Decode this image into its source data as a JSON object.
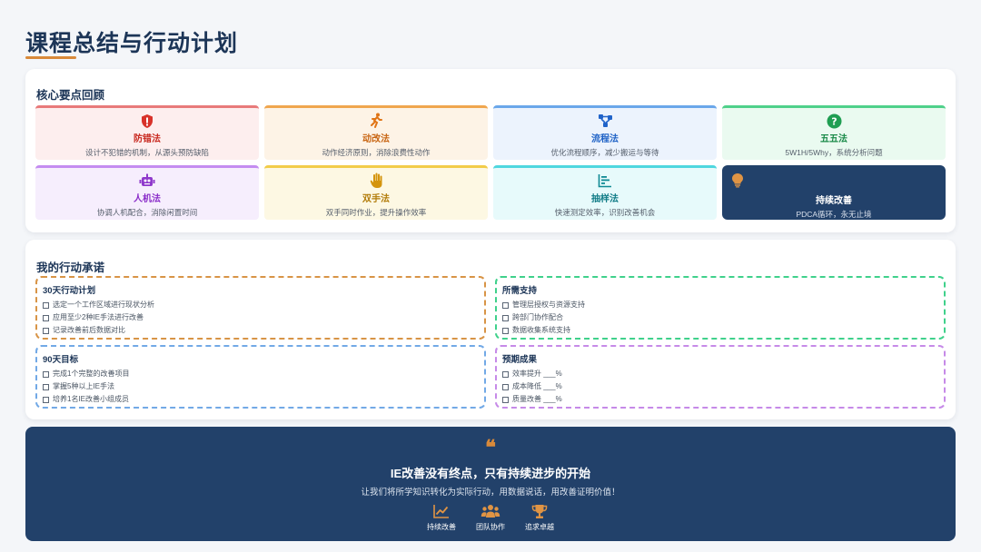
{
  "page": {
    "title": "课程总结与行动计划"
  },
  "key_points": {
    "title": "核心要点回顾",
    "cards": [
      {
        "name": "防错法",
        "desc": "设计不犯错的机制，从源头预防缺陷",
        "icon": "shield-icon",
        "accent": "#e87a7a"
      },
      {
        "name": "动改法",
        "desc": "动作经济原则，消除浪费性动作",
        "icon": "running-person-icon",
        "accent": "#f0a64e"
      },
      {
        "name": "流程法",
        "desc": "优化流程顺序，减少搬运与等待",
        "icon": "flow-network-icon",
        "accent": "#6aa7ea"
      },
      {
        "name": "五五法",
        "desc": "5W1H/5Why，系统分析问题",
        "icon": "question-circle-icon",
        "accent": "#4fd18a"
      },
      {
        "name": "人机法",
        "desc": "协调人机配合，消除闲置时间",
        "icon": "robot-icon",
        "accent": "#c48cf0"
      },
      {
        "name": "双手法",
        "desc": "双手同时作业，提升操作效率",
        "icon": "hand-icon",
        "accent": "#f2cc4a"
      },
      {
        "name": "抽样法",
        "desc": "快速测定效率，识别改善机会",
        "icon": "bar-chart-icon",
        "accent": "#4fd7df"
      },
      {
        "name": "持续改善",
        "desc": "PDCA循环，永无止境",
        "icon": "lightbulb-icon",
        "accent": "#22416a"
      }
    ]
  },
  "action": {
    "title": "我的行动承诺",
    "plans": [
      {
        "title": "30天行动计划",
        "items": [
          "选定一个工作区域进行现状分析",
          "应用至少2种IE手法进行改善",
          "记录改善前后数据对比"
        ]
      },
      {
        "title": "所需支持",
        "items": [
          "管理层授权与资源支持",
          "跨部门协作配合",
          "数据收集系统支持"
        ]
      },
      {
        "title": "90天目标",
        "items": [
          "完成1个完整的改善项目",
          "掌握5种以上IE手法",
          "培养1名IE改善小组成员"
        ]
      },
      {
        "title": "预期成果",
        "items": [
          "效率提升 ___%",
          "成本降低 ___%",
          "质量改善 ___%"
        ]
      }
    ]
  },
  "banner": {
    "quote": "❝",
    "headline": "IE改善没有终点，只有持续进步的开始",
    "sub": "让我们将所学知识转化为实际行动，用数据说话，用改善证明价值！",
    "badges": [
      {
        "label": "持续改善",
        "icon": "trend-chart-icon"
      },
      {
        "label": "团队协作",
        "icon": "team-icon"
      },
      {
        "label": "追求卓越",
        "icon": "trophy-icon"
      }
    ]
  },
  "colors": {
    "accent": "#d98a3a",
    "navy": "#22416a"
  }
}
